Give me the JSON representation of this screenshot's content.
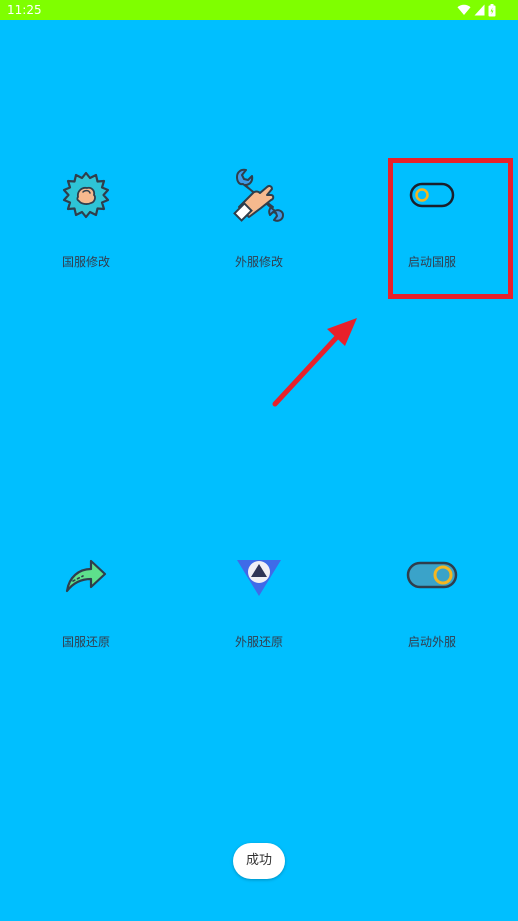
{
  "status_bar": {
    "time": "11:25",
    "background": "#7fff00",
    "icons": [
      "wifi-icon",
      "signal-icon",
      "battery-icon"
    ]
  },
  "app": {
    "background": "#00bfff"
  },
  "grid": {
    "items": [
      {
        "label": "国服修改",
        "icon": "gear-hand-icon"
      },
      {
        "label": "外服修改",
        "icon": "wrench-hand-icon"
      },
      {
        "label": "启动国服",
        "icon": "toggle-off-icon"
      },
      {
        "label": "国服还原",
        "icon": "share-arrow-icon"
      },
      {
        "label": "外服还原",
        "icon": "triangle-logo-icon"
      },
      {
        "label": "启动外服",
        "icon": "toggle-on-icon"
      }
    ]
  },
  "annotation": {
    "highlight_color": "#e8202a"
  },
  "toast": {
    "text": "成功"
  }
}
